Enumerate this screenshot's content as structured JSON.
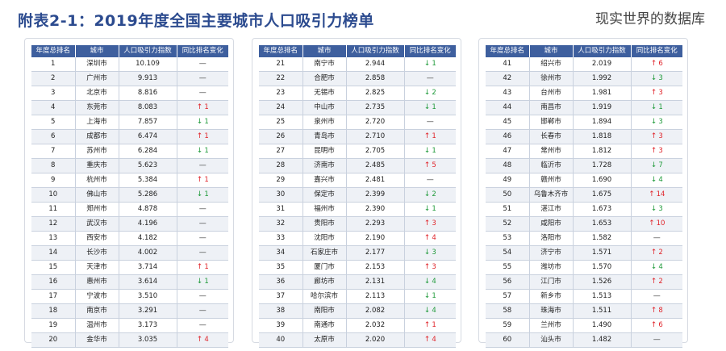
{
  "title": "附表2-1：2019年度全国主要城市人口吸引力榜单",
  "watermark": "现实世界的数据库",
  "headers": [
    "年度总排名",
    "城市",
    "人口吸引力指数",
    "同比排名变化"
  ],
  "colors": {
    "header_bg": "#3e5f9e",
    "up": "#e0242a",
    "down": "#1f9a3a",
    "title": "#2c4b8f"
  },
  "icons": {
    "up": "arrow-up-icon",
    "down": "arrow-down-icon",
    "flat": "dash"
  },
  "panels": [
    {
      "rows": [
        {
          "rank": "1",
          "city": "深圳市",
          "index": "10.109",
          "dir": "flat",
          "change": ""
        },
        {
          "rank": "2",
          "city": "广州市",
          "index": "9.913",
          "dir": "flat",
          "change": ""
        },
        {
          "rank": "3",
          "city": "北京市",
          "index": "8.816",
          "dir": "flat",
          "change": ""
        },
        {
          "rank": "4",
          "city": "东莞市",
          "index": "8.083",
          "dir": "up",
          "change": "1"
        },
        {
          "rank": "5",
          "city": "上海市",
          "index": "7.857",
          "dir": "down",
          "change": "1"
        },
        {
          "rank": "6",
          "city": "成都市",
          "index": "6.474",
          "dir": "up",
          "change": "1"
        },
        {
          "rank": "7",
          "city": "苏州市",
          "index": "6.284",
          "dir": "down",
          "change": "1"
        },
        {
          "rank": "8",
          "city": "重庆市",
          "index": "5.623",
          "dir": "flat",
          "change": ""
        },
        {
          "rank": "9",
          "city": "杭州市",
          "index": "5.384",
          "dir": "up",
          "change": "1"
        },
        {
          "rank": "10",
          "city": "佛山市",
          "index": "5.286",
          "dir": "down",
          "change": "1"
        },
        {
          "rank": "11",
          "city": "郑州市",
          "index": "4.878",
          "dir": "flat",
          "change": ""
        },
        {
          "rank": "12",
          "city": "武汉市",
          "index": "4.196",
          "dir": "flat",
          "change": ""
        },
        {
          "rank": "13",
          "city": "西安市",
          "index": "4.182",
          "dir": "flat",
          "change": ""
        },
        {
          "rank": "14",
          "city": "长沙市",
          "index": "4.002",
          "dir": "flat",
          "change": ""
        },
        {
          "rank": "15",
          "city": "天津市",
          "index": "3.714",
          "dir": "up",
          "change": "1"
        },
        {
          "rank": "16",
          "city": "惠州市",
          "index": "3.614",
          "dir": "down",
          "change": "1"
        },
        {
          "rank": "17",
          "city": "宁波市",
          "index": "3.510",
          "dir": "flat",
          "change": ""
        },
        {
          "rank": "18",
          "city": "南京市",
          "index": "3.291",
          "dir": "flat",
          "change": ""
        },
        {
          "rank": "19",
          "city": "温州市",
          "index": "3.173",
          "dir": "flat",
          "change": ""
        },
        {
          "rank": "20",
          "city": "金华市",
          "index": "3.035",
          "dir": "up",
          "change": "4"
        }
      ]
    },
    {
      "rows": [
        {
          "rank": "21",
          "city": "南宁市",
          "index": "2.944",
          "dir": "down",
          "change": "1"
        },
        {
          "rank": "22",
          "city": "合肥市",
          "index": "2.858",
          "dir": "flat",
          "change": ""
        },
        {
          "rank": "23",
          "city": "无锡市",
          "index": "2.825",
          "dir": "down",
          "change": "2"
        },
        {
          "rank": "24",
          "city": "中山市",
          "index": "2.735",
          "dir": "down",
          "change": "1"
        },
        {
          "rank": "25",
          "city": "泉州市",
          "index": "2.720",
          "dir": "flat",
          "change": ""
        },
        {
          "rank": "26",
          "city": "青岛市",
          "index": "2.710",
          "dir": "up",
          "change": "1"
        },
        {
          "rank": "27",
          "city": "昆明市",
          "index": "2.705",
          "dir": "down",
          "change": "1"
        },
        {
          "rank": "28",
          "city": "济南市",
          "index": "2.485",
          "dir": "up",
          "change": "5"
        },
        {
          "rank": "29",
          "city": "嘉兴市",
          "index": "2.481",
          "dir": "flat",
          "change": ""
        },
        {
          "rank": "30",
          "city": "保定市",
          "index": "2.399",
          "dir": "down",
          "change": "2"
        },
        {
          "rank": "31",
          "city": "福州市",
          "index": "2.390",
          "dir": "down",
          "change": "1"
        },
        {
          "rank": "32",
          "city": "贵阳市",
          "index": "2.293",
          "dir": "up",
          "change": "3"
        },
        {
          "rank": "33",
          "city": "沈阳市",
          "index": "2.190",
          "dir": "up",
          "change": "4"
        },
        {
          "rank": "34",
          "city": "石家庄市",
          "index": "2.177",
          "dir": "down",
          "change": "3"
        },
        {
          "rank": "35",
          "city": "厦门市",
          "index": "2.153",
          "dir": "up",
          "change": "3"
        },
        {
          "rank": "36",
          "city": "廊坊市",
          "index": "2.131",
          "dir": "down",
          "change": "4"
        },
        {
          "rank": "37",
          "city": "哈尔滨市",
          "index": "2.113",
          "dir": "down",
          "change": "1"
        },
        {
          "rank": "38",
          "city": "南阳市",
          "index": "2.082",
          "dir": "down",
          "change": "4"
        },
        {
          "rank": "39",
          "city": "南通市",
          "index": "2.032",
          "dir": "up",
          "change": "1"
        },
        {
          "rank": "40",
          "city": "太原市",
          "index": "2.020",
          "dir": "up",
          "change": "4"
        }
      ]
    },
    {
      "rows": [
        {
          "rank": "41",
          "city": "绍兴市",
          "index": "2.019",
          "dir": "up",
          "change": "6"
        },
        {
          "rank": "42",
          "city": "徐州市",
          "index": "1.992",
          "dir": "down",
          "change": "3"
        },
        {
          "rank": "43",
          "city": "台州市",
          "index": "1.981",
          "dir": "up",
          "change": "3"
        },
        {
          "rank": "44",
          "city": "南昌市",
          "index": "1.919",
          "dir": "down",
          "change": "1"
        },
        {
          "rank": "45",
          "city": "邯郸市",
          "index": "1.894",
          "dir": "down",
          "change": "3"
        },
        {
          "rank": "46",
          "city": "长春市",
          "index": "1.818",
          "dir": "up",
          "change": "3"
        },
        {
          "rank": "47",
          "city": "常州市",
          "index": "1.812",
          "dir": "up",
          "change": "3"
        },
        {
          "rank": "48",
          "city": "临沂市",
          "index": "1.728",
          "dir": "down",
          "change": "7"
        },
        {
          "rank": "49",
          "city": "赣州市",
          "index": "1.690",
          "dir": "down",
          "change": "4"
        },
        {
          "rank": "50",
          "city": "乌鲁木齐市",
          "index": "1.675",
          "dir": "up",
          "change": "14"
        },
        {
          "rank": "51",
          "city": "湛江市",
          "index": "1.673",
          "dir": "down",
          "change": "3"
        },
        {
          "rank": "52",
          "city": "咸阳市",
          "index": "1.653",
          "dir": "up",
          "change": "10"
        },
        {
          "rank": "53",
          "city": "洛阳市",
          "index": "1.582",
          "dir": "flat",
          "change": ""
        },
        {
          "rank": "54",
          "city": "济宁市",
          "index": "1.571",
          "dir": "up",
          "change": "2"
        },
        {
          "rank": "55",
          "city": "潍坊市",
          "index": "1.570",
          "dir": "down",
          "change": "4"
        },
        {
          "rank": "56",
          "city": "江门市",
          "index": "1.526",
          "dir": "up",
          "change": "2"
        },
        {
          "rank": "57",
          "city": "新乡市",
          "index": "1.513",
          "dir": "flat",
          "change": ""
        },
        {
          "rank": "58",
          "city": "珠海市",
          "index": "1.511",
          "dir": "up",
          "change": "8"
        },
        {
          "rank": "59",
          "city": "兰州市",
          "index": "1.490",
          "dir": "up",
          "change": "6"
        },
        {
          "rank": "60",
          "city": "汕头市",
          "index": "1.482",
          "dir": "flat",
          "change": ""
        }
      ]
    }
  ]
}
